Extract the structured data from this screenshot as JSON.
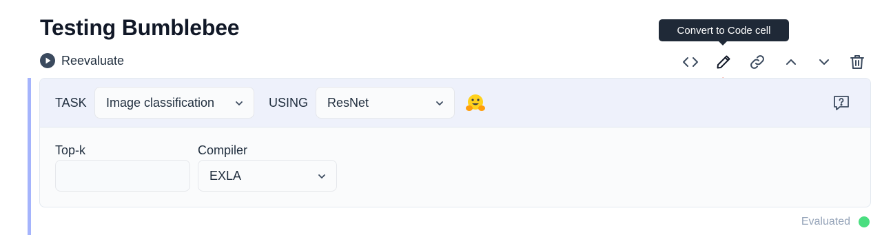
{
  "notebook": {
    "section_title": "Testing Bumblebee",
    "reevaluate_label": "Reevaluate"
  },
  "toolbar": {
    "tooltip": "Convert to Code cell",
    "buttons": [
      "code-icon",
      "pencil-icon",
      "link-icon",
      "chevron-up-icon",
      "chevron-down-icon",
      "trash-icon"
    ]
  },
  "smart_cell": {
    "task_caption": "TASK",
    "task_value": "Image classification",
    "using_caption": "USING",
    "model_value": "ResNet",
    "fields": {
      "top_k_label": "Top-k",
      "top_k_value": "",
      "compiler_label": "Compiler",
      "compiler_value": "EXLA"
    }
  },
  "status": {
    "text": "Evaluated",
    "color": "#4ade80"
  },
  "colors": {
    "accent": "#a5b4fc",
    "header_bg": "#eef1fb",
    "tooltip_bg": "#1f2937",
    "annotation_arrow": "#ef3b24"
  }
}
